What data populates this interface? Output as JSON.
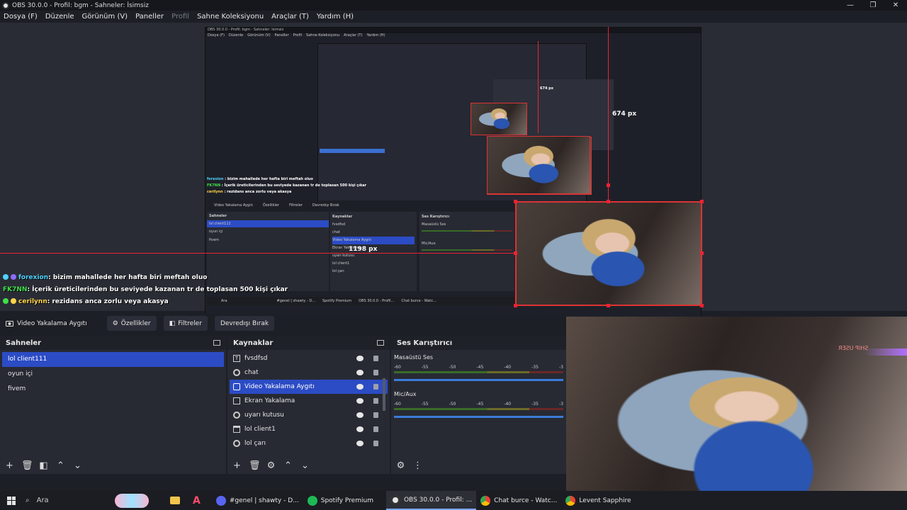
{
  "window": {
    "title": "OBS 30.0.0 - Profil: bgm - Sahneler: İsimsiz",
    "controls": [
      "—",
      "❐",
      "✕"
    ]
  },
  "menu": [
    "Dosya (F)",
    "Düzenle",
    "Görünüm (V)",
    "Paneller",
    "Profil",
    "Sahne Koleksiyonu",
    "Araçlar (T)",
    "Yardım (H)"
  ],
  "preview": {
    "nested_title": "OBS 30.0.0 - Profil: bgm - Sahneler: İsimsiz",
    "nested_menu": [
      "Dosya (F)",
      "Düzenle",
      "Görünüm (V)",
      "Paneller",
      "Profil",
      "Sahne Koleksiyonu",
      "Araçlar (T)",
      "Yardım (H)"
    ],
    "measure_height": "674 px",
    "measure_small": "674 px",
    "measure_width": "1198 px",
    "nested_context": [
      "Video Yakalama Aygıtı",
      "Özellikler",
      "Filtreler",
      "Devredışı Bırak"
    ],
    "nested_docks": [
      "Sahneler",
      "Kaynaklar",
      "Ses Karıştırıcı"
    ],
    "nested_scenes": [
      "lol client111",
      "oyun içi",
      "fivem"
    ],
    "nested_sources": [
      "fvsdfsd",
      "chat",
      "Video Yakalama Aygıtı",
      "Ekran Yakalama",
      "uyarı kutusu",
      "lol client1",
      "lol çarı"
    ],
    "nested_mixer": [
      "Masaüstü Ses",
      "Mic/Aux"
    ],
    "nested_taskbar": [
      "Ara",
      "#genel | shawty - D...",
      "Spotify Premium",
      "OBS 30.0.0 - Profil...",
      "Chat burce - Watc...",
      "Levent Sapphire"
    ],
    "nested_chat": [
      {
        "user": "forexion",
        "text": ": bizim mahallede her hafta biri meftah oluo"
      },
      {
        "user": "FK7NN",
        "text": ": İçerik üreticilerinden bu seviyede kazanan tr de toplasan 500 kişi çıkar"
      },
      {
        "user": "cerilynn",
        "text": ": rezidans anca zorlu veya akasya"
      }
    ]
  },
  "chat": [
    {
      "user": "forexion",
      "text": ": bizim mahallede her hafta biri meftah oluo"
    },
    {
      "user": "FK7NN",
      "text": ": İçerik üreticilerinden bu seviyede kazanan tr de toplasan 500 kişi çıkar"
    },
    {
      "user": "cerilynn",
      "text": ": rezidans anca zorlu veya akasya"
    }
  ],
  "context_bar": {
    "source": "Video Yakalama Aygıtı",
    "properties": "Özellikler",
    "filters": "Filtreler",
    "disable": "Devredışı Bırak"
  },
  "scenes": {
    "title": "Sahneler",
    "items": [
      "lol client111",
      "oyun içi",
      "fivem"
    ],
    "selected": 0
  },
  "sources": {
    "title": "Kaynaklar",
    "items": [
      {
        "label": "fvsdfsd",
        "icon": "text-icon"
      },
      {
        "label": "chat",
        "icon": "browser-icon"
      },
      {
        "label": "Video Yakalama Aygıtı",
        "icon": "camera-icon"
      },
      {
        "label": "Ekran Yakalama",
        "icon": "monitor-icon"
      },
      {
        "label": "uyarı kutusu",
        "icon": "browser-icon"
      },
      {
        "label": "lol client1",
        "icon": "window-icon"
      },
      {
        "label": "lol çarı",
        "icon": "browser-icon"
      }
    ],
    "selected": 2
  },
  "mixer": {
    "title": "Ses Karıştırıcı",
    "channels": [
      {
        "name": "Masaüstü Ses",
        "ticks": [
          "-60",
          "-55",
          "-50",
          "-45",
          "-40",
          "-35",
          "-3"
        ]
      },
      {
        "name": "Mic/Aux",
        "ticks": [
          "-60",
          "-55",
          "-50",
          "-45",
          "-40",
          "-35",
          "-3"
        ]
      }
    ]
  },
  "webcam": {
    "sign_text": "SHIP USER"
  },
  "taskbar": {
    "search": "Ara",
    "apps": [
      {
        "label": "#genel | shawty - D...",
        "color": "#5865f2"
      },
      {
        "label": "Spotify Premium",
        "color": "#1db954"
      },
      {
        "label": "OBS 30.0.0 - Profil: ...",
        "color": "#e6e6e6",
        "active": true
      },
      {
        "label": "Chat burce - Watc...",
        "color": "#4285f4"
      },
      {
        "label": "Levent Sapphire",
        "color": "#4285f4"
      }
    ]
  }
}
